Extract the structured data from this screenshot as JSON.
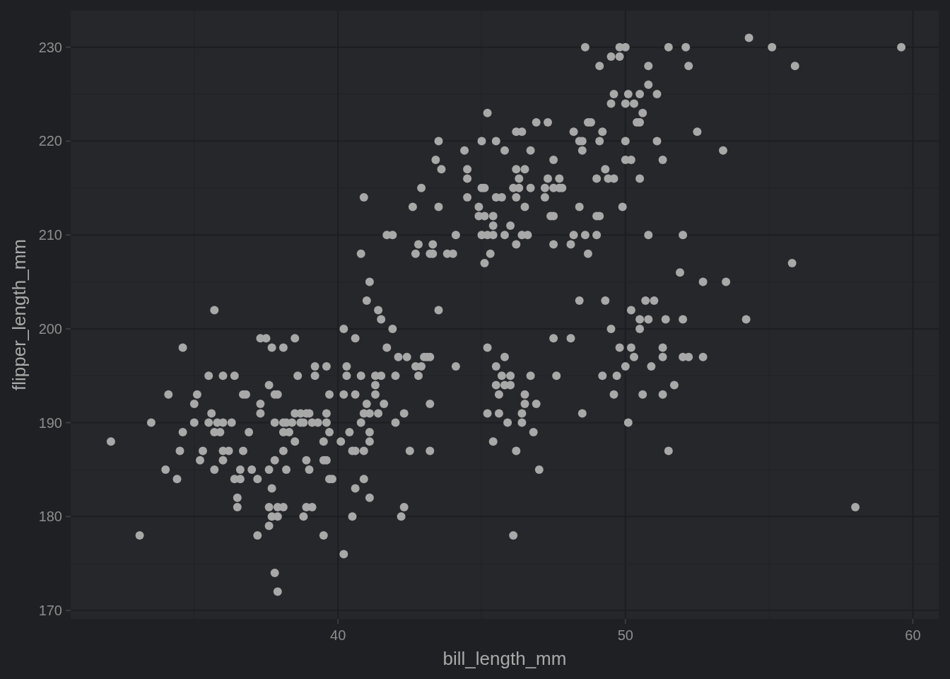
{
  "chart_data": {
    "type": "scatter",
    "xlabel": "bill_length_mm",
    "ylabel": "flipper_length_mm",
    "xlim": [
      30.7,
      60.9
    ],
    "ylim": [
      169.1,
      233.9
    ],
    "xticks": [
      40,
      50,
      60
    ],
    "yticks": [
      170,
      180,
      190,
      200,
      210,
      220,
      230
    ],
    "grid": true,
    "x": [
      32.1,
      33.1,
      33.5,
      34.0,
      34.1,
      34.4,
      34.5,
      34.6,
      34.6,
      35.0,
      35.0,
      35.1,
      35.2,
      35.3,
      35.5,
      35.5,
      35.6,
      35.7,
      35.7,
      35.7,
      35.8,
      35.9,
      36.0,
      36.0,
      36.0,
      36.0,
      36.2,
      36.3,
      36.4,
      36.4,
      36.5,
      36.5,
      36.6,
      36.6,
      36.7,
      36.7,
      36.8,
      36.9,
      37.0,
      37.2,
      37.2,
      37.3,
      37.3,
      37.3,
      37.5,
      37.6,
      37.6,
      37.6,
      37.6,
      37.7,
      37.7,
      37.7,
      37.8,
      37.8,
      37.8,
      37.8,
      37.9,
      37.9,
      37.9,
      37.9,
      38.1,
      38.1,
      38.1,
      38.1,
      38.1,
      38.2,
      38.2,
      38.3,
      38.4,
      38.5,
      38.5,
      38.5,
      38.6,
      38.7,
      38.7,
      38.8,
      38.8,
      38.9,
      38.9,
      38.9,
      39.0,
      39.0,
      39.1,
      39.1,
      39.2,
      39.2,
      39.3,
      39.5,
      39.5,
      39.5,
      39.6,
      39.6,
      39.6,
      39.6,
      39.7,
      39.7,
      39.7,
      39.8,
      40.1,
      40.2,
      40.2,
      40.2,
      40.3,
      40.3,
      40.4,
      40.5,
      40.5,
      40.6,
      40.6,
      40.6,
      40.6,
      40.8,
      40.8,
      40.8,
      40.9,
      40.9,
      40.9,
      40.9,
      41.0,
      41.0,
      41.1,
      41.1,
      41.1,
      41.1,
      41.1,
      41.3,
      41.3,
      41.3,
      41.4,
      41.4,
      41.5,
      41.5,
      41.6,
      41.7,
      41.7,
      41.9,
      41.9,
      42.0,
      42.0,
      42.1,
      42.2,
      42.3,
      42.3,
      42.4,
      42.5,
      42.6,
      42.7,
      42.7,
      42.8,
      42.8,
      42.9,
      42.9,
      43.0,
      43.1,
      43.2,
      43.2,
      43.2,
      43.2,
      43.3,
      43.3,
      43.4,
      43.5,
      43.5,
      43.5,
      43.6,
      43.8,
      44.0,
      44.1,
      44.1,
      44.4,
      44.5,
      44.5,
      44.5,
      44.9,
      44.9,
      45.0,
      45.0,
      45.0,
      45.1,
      45.1,
      45.1,
      45.2,
      45.2,
      45.2,
      45.2,
      45.3,
      45.4,
      45.4,
      45.4,
      45.4,
      45.5,
      45.5,
      45.5,
      45.5,
      45.6,
      45.6,
      45.7,
      45.7,
      45.8,
      45.8,
      45.8,
      45.8,
      45.9,
      46.0,
      46.0,
      46.0,
      46.1,
      46.1,
      46.2,
      46.2,
      46.2,
      46.2,
      46.2,
      46.3,
      46.3,
      46.4,
      46.4,
      46.4,
      46.4,
      46.5,
      46.5,
      46.5,
      46.5,
      46.6,
      46.7,
      46.7,
      46.7,
      46.8,
      46.9,
      46.9,
      47.0,
      47.2,
      47.2,
      47.3,
      47.3,
      47.4,
      47.5,
      47.5,
      47.5,
      47.5,
      47.5,
      47.6,
      47.7,
      47.7,
      47.8,
      48.1,
      48.1,
      48.2,
      48.2,
      48.4,
      48.4,
      48.4,
      48.5,
      48.5,
      48.5,
      48.6,
      48.6,
      48.7,
      48.7,
      48.8,
      49.0,
      49.0,
      49.0,
      49.1,
      49.1,
      49.1,
      49.2,
      49.2,
      49.3,
      49.3,
      49.4,
      49.5,
      49.5,
      49.5,
      49.6,
      49.6,
      49.6,
      49.7,
      49.8,
      49.8,
      49.8,
      49.9,
      50.0,
      50.0,
      50.0,
      50.0,
      50.0,
      50.1,
      50.1,
      50.2,
      50.2,
      50.2,
      50.3,
      50.3,
      50.4,
      50.5,
      50.5,
      50.5,
      50.5,
      50.5,
      50.6,
      50.6,
      50.7,
      50.8,
      50.8,
      50.8,
      50.8,
      50.9,
      51.0,
      51.1,
      51.1,
      51.3,
      51.3,
      51.3,
      51.3,
      51.4,
      51.5,
      51.5,
      51.7,
      51.9,
      52.0,
      52.0,
      52.0,
      52.1,
      52.2,
      52.2,
      52.5,
      52.7,
      52.7,
      53.4,
      53.5,
      54.2,
      54.3,
      55.1,
      55.8,
      55.9,
      58.0,
      59.6
    ],
    "values": [
      188,
      178,
      190,
      185,
      193,
      184,
      187,
      198,
      189,
      192,
      190,
      193,
      186,
      187,
      195,
      190,
      191,
      202,
      189,
      185,
      190,
      189,
      190,
      186,
      195,
      187,
      187,
      190,
      184,
      195,
      182,
      181,
      184,
      185,
      193,
      187,
      193,
      189,
      185,
      178,
      184,
      199,
      192,
      191,
      199,
      179,
      185,
      194,
      181,
      198,
      183,
      180,
      193,
      190,
      174,
      186,
      180,
      193,
      172,
      181,
      189,
      198,
      187,
      190,
      181,
      190,
      185,
      189,
      190,
      188,
      199,
      191,
      195,
      191,
      190,
      180,
      190,
      191,
      181,
      186,
      185,
      191,
      181,
      190,
      196,
      195,
      190,
      186,
      188,
      178,
      196,
      191,
      186,
      190,
      184,
      193,
      189,
      184,
      188,
      200,
      176,
      193,
      196,
      195,
      189,
      187,
      180,
      187,
      193,
      199,
      183,
      190,
      195,
      208,
      214,
      187,
      184,
      191,
      192,
      203,
      205,
      182,
      188,
      189,
      191,
      193,
      194,
      195,
      202,
      191,
      201,
      195,
      192,
      210,
      198,
      200,
      210,
      190,
      195,
      197,
      180,
      191,
      181,
      197,
      187,
      213,
      208,
      196,
      209,
      195,
      215,
      196,
      197,
      197,
      208,
      192,
      187,
      197,
      208,
      209,
      218,
      213,
      202,
      220,
      217,
      208,
      208,
      196,
      210,
      219,
      217,
      216,
      214,
      213,
      212,
      220,
      215,
      210,
      207,
      215,
      212,
      198,
      223,
      191,
      210,
      208,
      211,
      210,
      188,
      212,
      214,
      220,
      196,
      194,
      191,
      193,
      195,
      214,
      219,
      210,
      197,
      194,
      190,
      195,
      194,
      211,
      178,
      215,
      209,
      187,
      214,
      221,
      217,
      215,
      216,
      221,
      191,
      190,
      210,
      217,
      213,
      192,
      193,
      210,
      219,
      195,
      215,
      189,
      192,
      222,
      185,
      214,
      215,
      222,
      216,
      212,
      212,
      209,
      199,
      218,
      215,
      195,
      216,
      215,
      215,
      199,
      209,
      210,
      221,
      220,
      213,
      203,
      219,
      191,
      220,
      230,
      210,
      222,
      208,
      222,
      216,
      212,
      210,
      228,
      212,
      220,
      221,
      195,
      217,
      203,
      216,
      200,
      229,
      224,
      216,
      225,
      193,
      195,
      230,
      229,
      198,
      213,
      230,
      220,
      218,
      224,
      196,
      225,
      190,
      202,
      218,
      198,
      224,
      197,
      222,
      222,
      216,
      201,
      200,
      225,
      223,
      193,
      203,
      226,
      228,
      210,
      201,
      196,
      203,
      225,
      220,
      198,
      197,
      193,
      218,
      201,
      230,
      187,
      194,
      206,
      201,
      210,
      197,
      230,
      197,
      228,
      221,
      197,
      205,
      219,
      205,
      201,
      231,
      230,
      207,
      228,
      181,
      230
    ]
  }
}
